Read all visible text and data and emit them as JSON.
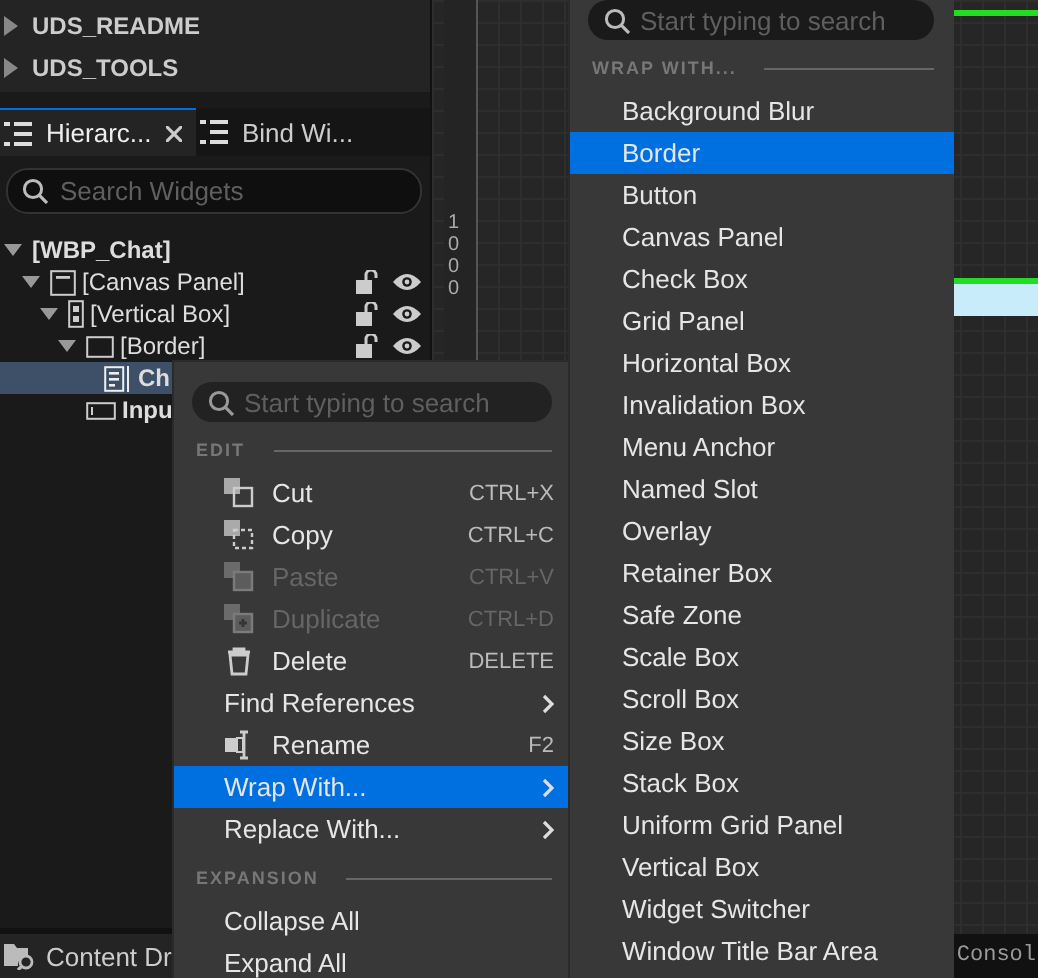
{
  "folders": [
    {
      "label": "UDS_README",
      "expanded": false
    },
    {
      "label": "UDS_TOOLS",
      "expanded": false
    }
  ],
  "tabs": [
    {
      "label": "Hierarc...",
      "selected": true,
      "closable": true
    },
    {
      "label": "Bind Wi...",
      "selected": false,
      "closable": false
    }
  ],
  "hierarchy_search": {
    "placeholder": "Search Widgets"
  },
  "tree": [
    {
      "label": "[WBP_Chat]",
      "expanded": true,
      "selected": false,
      "children": [
        {
          "label": "[Canvas Panel]",
          "expanded": true,
          "selected": false,
          "children": [
            {
              "label": "[Vertical Box]",
              "expanded": true,
              "selected": false,
              "children": [
                {
                  "label": "[Border]",
                  "expanded": true,
                  "selected": false,
                  "children": [
                    {
                      "label": "Ch",
                      "selected": true
                    }
                  ]
                },
                {
                  "label": "Inpu",
                  "selected": false
                }
              ]
            }
          ]
        }
      ]
    }
  ],
  "ruler_label": "1000",
  "bottom_tab": "Content Dr",
  "console_tab": "Consol",
  "context_menu": {
    "search": {
      "placeholder": "Start typing to search"
    },
    "sections": [
      {
        "header": "EDIT",
        "items": [
          {
            "label": "Cut",
            "shortcut": "CTRL+X",
            "disabled": false,
            "selected": false,
            "submenu": false
          },
          {
            "label": "Copy",
            "shortcut": "CTRL+C",
            "disabled": false,
            "selected": false,
            "submenu": false
          },
          {
            "label": "Paste",
            "shortcut": "CTRL+V",
            "disabled": true,
            "selected": false,
            "submenu": false
          },
          {
            "label": "Duplicate",
            "shortcut": "CTRL+D",
            "disabled": true,
            "selected": false,
            "submenu": false
          },
          {
            "label": "Delete",
            "shortcut": "DELETE",
            "disabled": false,
            "selected": false,
            "submenu": false
          },
          {
            "label": "Find References",
            "disabled": false,
            "selected": false,
            "submenu": true
          },
          {
            "label": "Rename",
            "shortcut": "F2",
            "disabled": false,
            "selected": false,
            "submenu": false
          },
          {
            "label": "Wrap With...",
            "disabled": false,
            "selected": true,
            "submenu": true
          },
          {
            "label": "Replace With...",
            "disabled": false,
            "selected": false,
            "submenu": true
          }
        ]
      },
      {
        "header": "EXPANSION",
        "items": [
          {
            "label": "Collapse All",
            "disabled": false,
            "selected": false,
            "submenu": false
          },
          {
            "label": "Expand All",
            "disabled": false,
            "selected": false,
            "submenu": false
          }
        ]
      }
    ]
  },
  "submenu": {
    "search": {
      "placeholder": "Start typing to search"
    },
    "header": "WRAP WITH...",
    "items": [
      {
        "label": "Background Blur",
        "selected": false
      },
      {
        "label": "Border",
        "selected": true
      },
      {
        "label": "Button",
        "selected": false
      },
      {
        "label": "Canvas Panel",
        "selected": false
      },
      {
        "label": "Check Box",
        "selected": false
      },
      {
        "label": "Grid Panel",
        "selected": false
      },
      {
        "label": "Horizontal Box",
        "selected": false
      },
      {
        "label": "Invalidation Box",
        "selected": false
      },
      {
        "label": "Menu Anchor",
        "selected": false
      },
      {
        "label": "Named Slot",
        "selected": false
      },
      {
        "label": "Overlay",
        "selected": false
      },
      {
        "label": "Retainer Box",
        "selected": false
      },
      {
        "label": "Safe Zone",
        "selected": false
      },
      {
        "label": "Scale Box",
        "selected": false
      },
      {
        "label": "Scroll Box",
        "selected": false
      },
      {
        "label": "Size Box",
        "selected": false
      },
      {
        "label": "Stack Box",
        "selected": false
      },
      {
        "label": "Uniform Grid Panel",
        "selected": false
      },
      {
        "label": "Vertical Box",
        "selected": false
      },
      {
        "label": "Widget Switcher",
        "selected": false
      },
      {
        "label": "Window Title Bar Area",
        "selected": false
      }
    ]
  }
}
